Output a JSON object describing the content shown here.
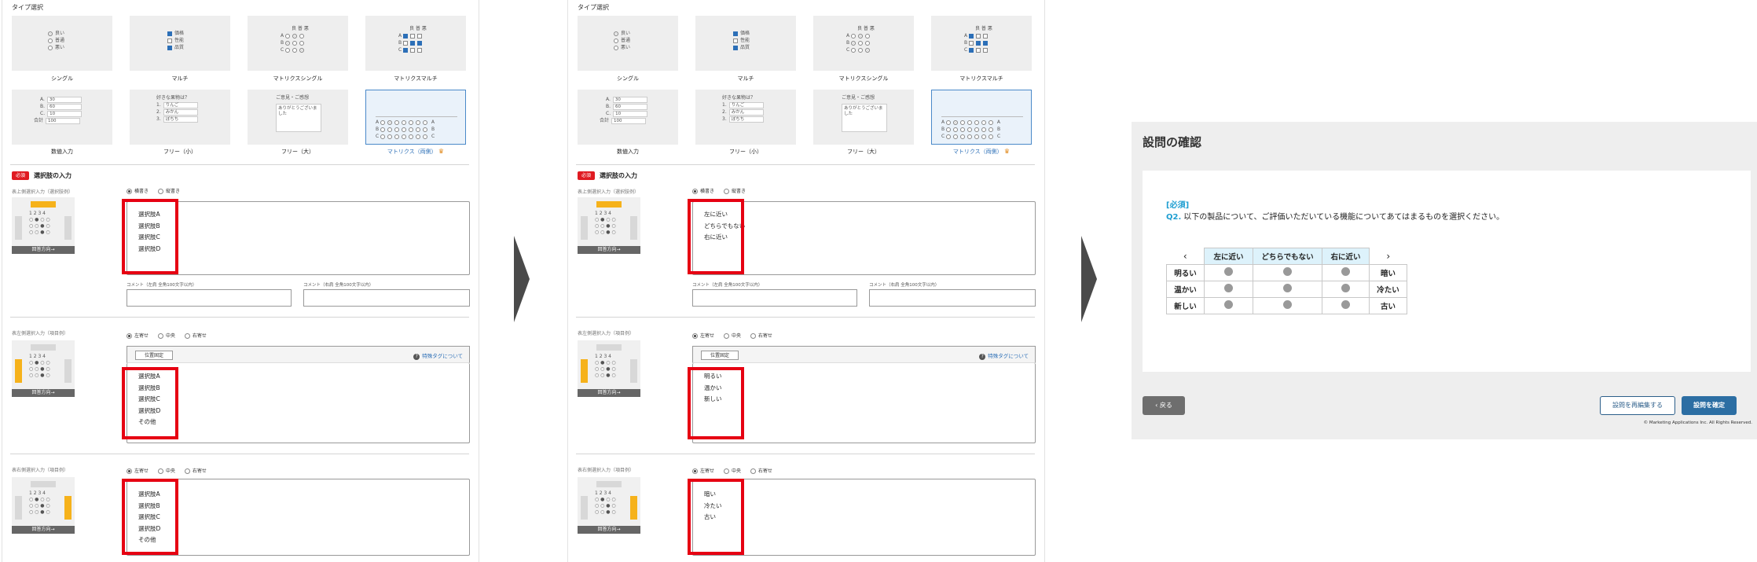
{
  "editor": {
    "type_section_label": "タイプ選択",
    "types": [
      {
        "label": "シングル"
      },
      {
        "label": "マルチ"
      },
      {
        "label": "マトリクスシングル"
      },
      {
        "label": "マトリクスマルチ"
      },
      {
        "label": "数値入力"
      },
      {
        "label": "フリー（小）"
      },
      {
        "label": "フリー（大）"
      },
      {
        "label": "マトリクス（両側）"
      }
    ],
    "selected_type": "マトリクス（両側）",
    "previews": {
      "single": [
        "良い",
        "普通",
        "悪い"
      ],
      "multi": [
        "価格",
        "性能",
        "品質"
      ],
      "matrix_header": "良 普 悪",
      "matrix_rows": [
        "A",
        "B",
        "C"
      ],
      "numeric_rows": [
        "A.",
        "B.",
        "C."
      ],
      "numeric_values": [
        "30",
        "60",
        "10"
      ],
      "numeric_total_label": "合計",
      "numeric_total": "100",
      "free_small_question": "好きな果物は？",
      "free_small_rows": [
        "1.",
        "2.",
        "3."
      ],
      "free_small_values": [
        "りんご",
        "みかん",
        "ぼちち"
      ],
      "free_large_question": "ご意見・ご感想",
      "free_large_value": "ありがとうございました"
    },
    "choice_section": {
      "required_badge": "必須",
      "title": "選択肢の入力",
      "direction_label": "回答方向→"
    },
    "blocks": [
      {
        "sublabel": "表上側選択入力（選択肢例）",
        "radios": [
          "横書き",
          "縦書き"
        ],
        "comment_left": "コメント（左肩 全角100文字以内）",
        "comment_right": "コメント（右肩 全角100文字以内）"
      },
      {
        "sublabel": "表左側選択入力（項目例）",
        "radios": [
          "左寄せ",
          "中央",
          "右寄せ"
        ],
        "position_button": "位置固定",
        "tag_help": "特殊タグについて"
      },
      {
        "sublabel": "表右側選択入力（項目例）",
        "radios": [
          "左寄せ",
          "中央",
          "右寄せ"
        ]
      }
    ],
    "before": {
      "top_values": [
        "選択肢A",
        "選択肢B",
        "選択肢C",
        "選択肢D"
      ],
      "left_values": [
        "選択肢A",
        "選択肢B",
        "選択肢C",
        "選択肢D",
        "その他"
      ],
      "right_values": [
        "選択肢A",
        "選択肢B",
        "選択肢C",
        "選択肢D",
        "その他"
      ]
    },
    "after": {
      "top_values": [
        "左に近い",
        "どちらでもない",
        "右に近い"
      ],
      "left_values": [
        "明るい",
        "温かい",
        "新しい"
      ],
      "right_values": [
        "暗い",
        "冷たい",
        "古い"
      ]
    }
  },
  "confirm": {
    "title": "設問の確認",
    "required_tag": "[必須]",
    "question_number": "Q2.",
    "question_text": "以下の製品について、ご評価いただいている機能についてあてはまるものを選択ください。",
    "nav_prev": "‹",
    "nav_next": "›",
    "columns": [
      "左に近い",
      "どちらでもない",
      "右に近い"
    ],
    "rows": [
      {
        "left": "明るい",
        "right": "暗い"
      },
      {
        "left": "温かい",
        "right": "冷たい"
      },
      {
        "left": "新しい",
        "right": "古い"
      }
    ],
    "back_button": "戻る",
    "reedit_button": "設問を再編集する",
    "confirm_button": "設問を確定",
    "copyright": "© Marketing Applications Inc. All Rights Reserved."
  }
}
